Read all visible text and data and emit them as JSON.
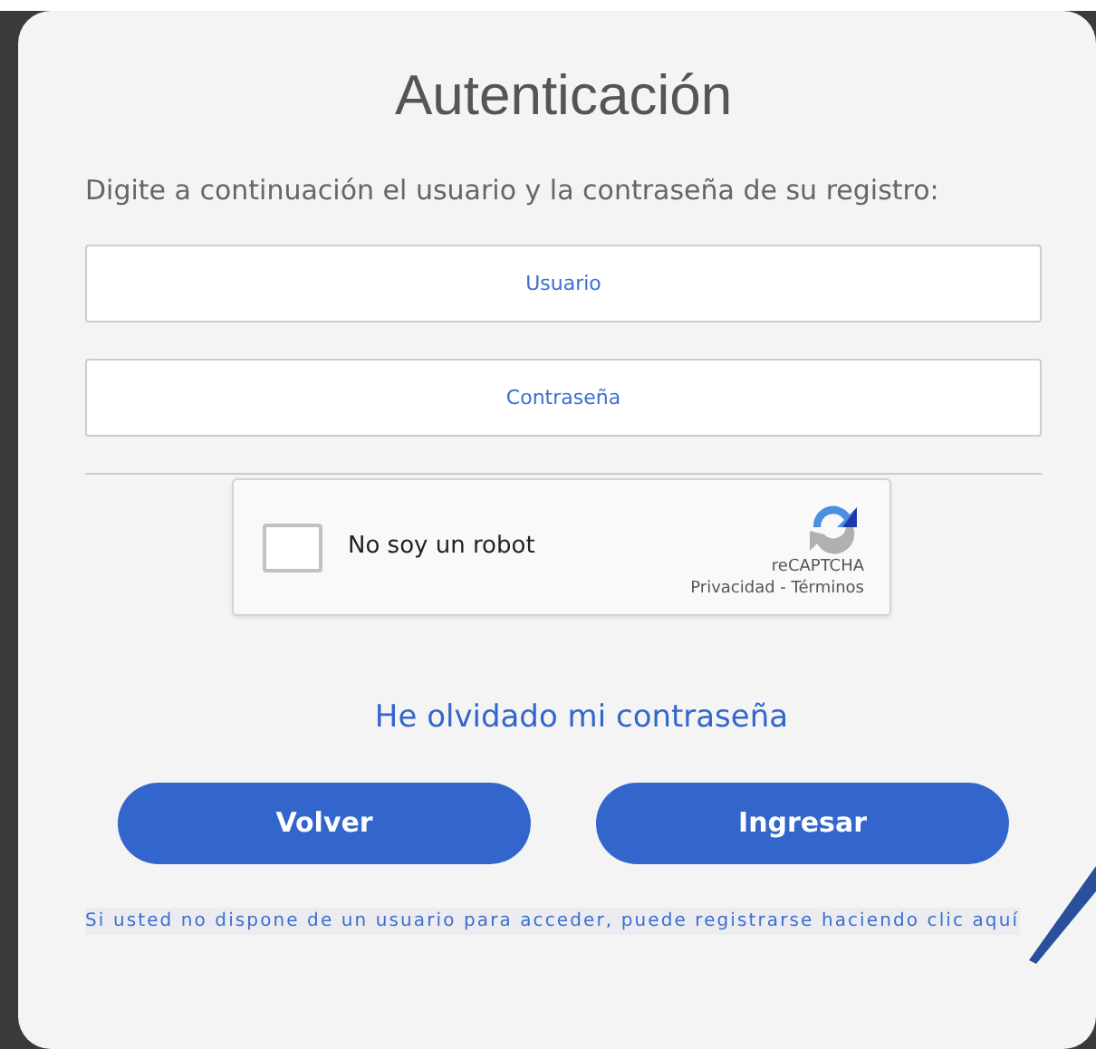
{
  "title": "Autenticación",
  "instructions": "Digite a continuación el usuario y la contraseña de su registro:",
  "fields": [
    {
      "placeholder": "Usuario"
    },
    {
      "placeholder": "Contraseña"
    }
  ],
  "captcha": {
    "label": "No soy un robot",
    "checked": false,
    "brand": "reCAPTCHA",
    "links": "Privacidad - Términos"
  },
  "forgot_link": "He olvidado mi contraseña",
  "buttons": [
    "Volver",
    "Ingresar"
  ],
  "register_note": "Si usted no dispone de un usuario para acceder, puede registrarse haciendo clic aquí"
}
